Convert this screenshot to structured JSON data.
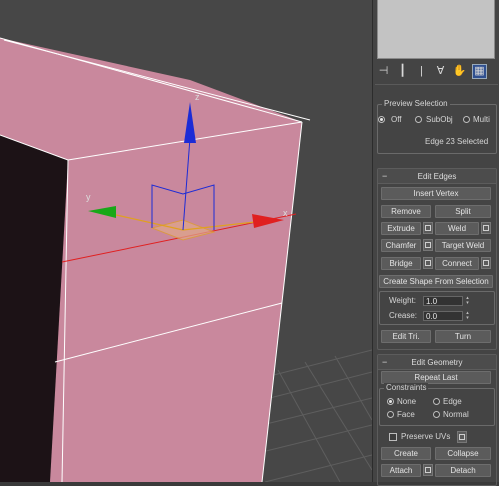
{
  "viewport": {
    "axis_y_label": "y",
    "axis_z_label": "z",
    "axis_x_label": "x",
    "colors": {
      "background": "#474747",
      "mesh": "#c9889d",
      "mesh_dark": "#1c1216",
      "edge": "#ffffff",
      "x_axis": "#e02020",
      "y_axis": "#18a818",
      "z_axis": "#1c2bd6",
      "gizmo_plane": "#e0a020"
    }
  },
  "toolbar": {
    "icons": [
      "pin-icon",
      "modifier-bar-icon",
      "separator",
      "funnel-icon",
      "hand-icon",
      "configure-icon"
    ]
  },
  "preview_selection": {
    "title": "Preview Selection",
    "options": [
      "Off",
      "SubObj",
      "Multi"
    ],
    "selected": "Off",
    "status": "Edge 23 Selected"
  },
  "edit_edges": {
    "title": "Edit Edges",
    "insert_vertex": "Insert Vertex",
    "remove": "Remove",
    "split": "Split",
    "extrude": "Extrude",
    "weld": "Weld",
    "chamfer": "Chamfer",
    "target_weld": "Target Weld",
    "bridge": "Bridge",
    "connect": "Connect",
    "create_shape": "Create Shape From Selection",
    "weight_label": "Weight:",
    "weight_value": "1.0",
    "crease_label": "Crease:",
    "crease_value": "0.0",
    "edit_tri": "Edit Tri.",
    "turn": "Turn"
  },
  "edit_geometry": {
    "title": "Edit Geometry",
    "repeat_last": "Repeat Last",
    "constraints_label": "Constraints",
    "constraints": [
      "None",
      "Edge",
      "Face",
      "Normal"
    ],
    "selected_constraint": "None",
    "preserve_uvs": "Preserve UVs",
    "create": "Create",
    "collapse": "Collapse",
    "attach": "Attach",
    "detach": "Detach"
  }
}
